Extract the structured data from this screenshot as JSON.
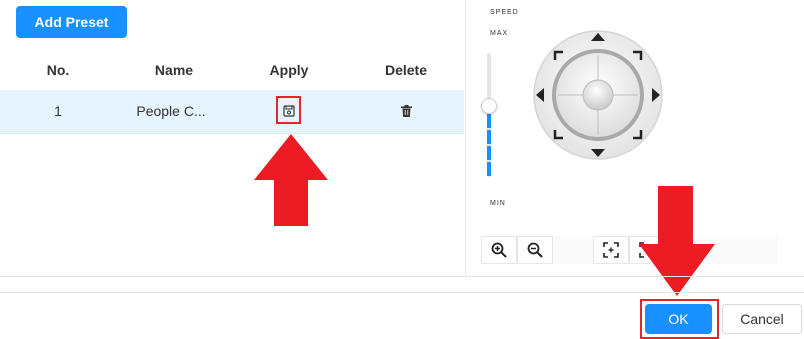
{
  "toolbar": {
    "add_preset_label": "Add Preset"
  },
  "table": {
    "columns": [
      "No.",
      "Name",
      "Apply",
      "Delete"
    ],
    "rows": [
      {
        "no": "1",
        "name": "People C...",
        "apply_icon": "save-icon",
        "delete_icon": "trash-icon"
      }
    ]
  },
  "ptz": {
    "speed_label": "SPEED",
    "max_label": "MAX",
    "min_label": "MIN",
    "speed_level": 0.6,
    "directions": [
      "up",
      "down",
      "left",
      "right",
      "up-left",
      "up-right",
      "down-left",
      "down-right"
    ],
    "tools": [
      "zoom-in-icon",
      "zoom-out-icon",
      "focus-frame-icon",
      "focus-frame-icon"
    ]
  },
  "footer": {
    "ok_label": "OK",
    "cancel_label": "Cancel"
  },
  "colors": {
    "accent": "#1890ff",
    "highlight_row": "#e6f4fd",
    "annotation_red": "#e3262b"
  }
}
